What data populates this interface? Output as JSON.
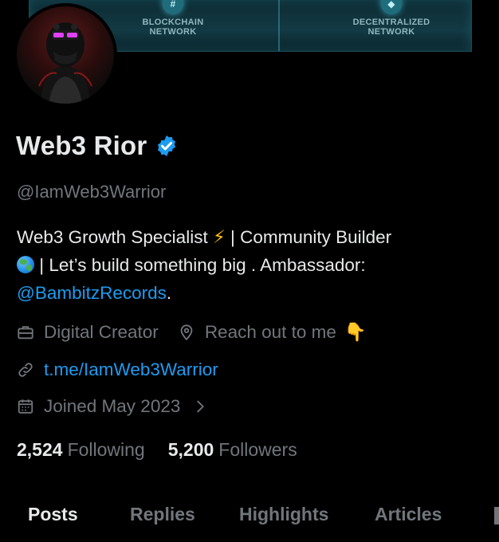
{
  "banner": {
    "left_tile": {
      "line1": "BLOCKCHAIN",
      "line2": "NETWORK",
      "icon": "hash-icon"
    },
    "right_tile": {
      "line1": "DECENTRALIZED",
      "line2": "NETWORK",
      "icon": "shield-icon"
    }
  },
  "profile": {
    "name": "Web3 Rior",
    "handle": "@IamWeb3Warrior",
    "bio": {
      "line1_text": "Web3 Growth Specialist ",
      "line1_emoji": "⚡",
      "line1_rest": " | Community Builder",
      "line2_text": " | Let’s build something big . Ambassador:",
      "mention": "@BambitzRecords",
      "mention_suffix": "."
    },
    "category": "Digital Creator",
    "location": "Reach out to me",
    "location_emoji": "👇",
    "website": "t.me/IamWeb3Warrior",
    "joined": "Joined May 2023"
  },
  "stats": {
    "following_count": "2,524",
    "following_label": "Following",
    "followers_count": "5,200",
    "followers_label": "Followers"
  },
  "tabs": [
    {
      "label": "Posts",
      "active": true
    },
    {
      "label": "Replies",
      "active": false
    },
    {
      "label": "Highlights",
      "active": false
    },
    {
      "label": "Articles",
      "active": false
    }
  ],
  "colors": {
    "background": "#000000",
    "text_primary": "#e7e9ea",
    "text_secondary": "#71767b",
    "link": "#1d9bf0",
    "verified_badge": "#1d9bf0"
  }
}
